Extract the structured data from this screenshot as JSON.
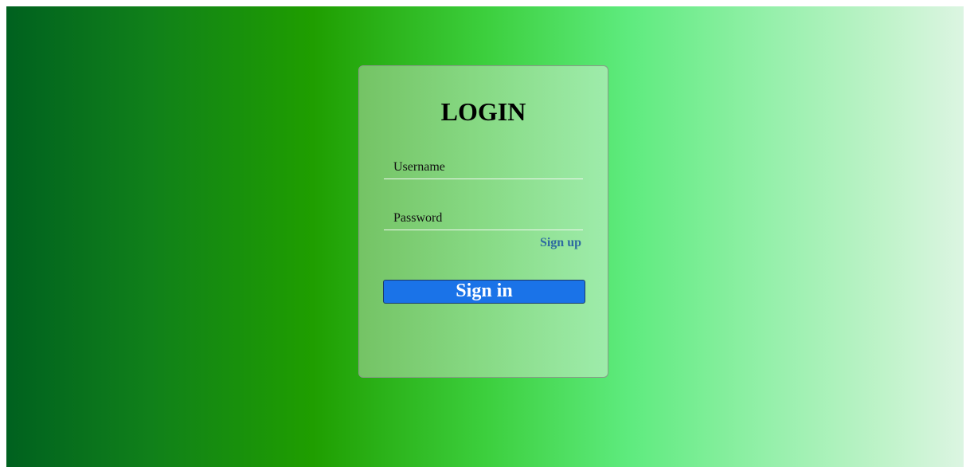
{
  "login": {
    "title": "LOGIN",
    "username_placeholder": "Username",
    "password_placeholder": "Password",
    "signup_label": "Sign up",
    "signin_label": "Sign in"
  },
  "colors": {
    "gradient_start": "#00611f",
    "gradient_end": "#dcf5e2",
    "button": "#1a73e8",
    "signup_link": "#2e6aa0"
  }
}
